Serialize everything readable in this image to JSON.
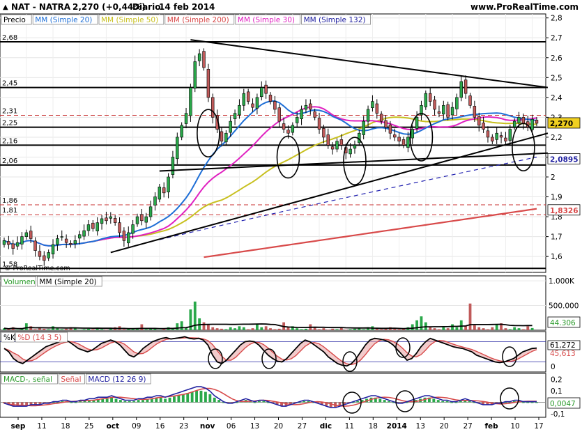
{
  "header": {
    "symbol": "NAT - NATRA",
    "last": "2,270 (+0,44%)",
    "period": "Diario",
    "date": "14 feb 2014",
    "site": "www.ProRealTime.com"
  },
  "price_panel": {
    "legend": [
      {
        "text": "Precio",
        "color": "#000000"
      },
      {
        "text": "MM (Simple 20)",
        "color": "#1f6fd6"
      },
      {
        "text": "MM (Simple 50)",
        "color": "#c8c020"
      },
      {
        "text": "MM (Simple 200)",
        "color": "#d84a4a"
      },
      {
        "text": "MM (Simple 30)",
        "color": "#e020c0"
      },
      {
        "text": "MM (Simple 132)",
        "color": "#2020a0"
      }
    ],
    "watermark": "© ProRealTime.com",
    "level_labels": [
      "2,68",
      "2,45",
      "2,31",
      "2,25",
      "2,16",
      "2,06",
      "1,86",
      "1,81",
      "1,58"
    ],
    "last_badge": "2,270",
    "badge_sma20": "2,0895",
    "badge_sma200": "1,8326"
  },
  "volume_panel": {
    "legend": [
      {
        "text": "Volumen",
        "color": "#000000"
      },
      {
        "text": "MM (Simple 20)",
        "color": "#000000"
      }
    ],
    "axis_labels": [
      "1.000K",
      "500.000"
    ],
    "badge": "44.306"
  },
  "stoch_panel": {
    "legend": [
      {
        "text": "%K",
        "color": "#000000"
      },
      {
        "text": "%D (14 3 5)",
        "color": "#d84a4a"
      }
    ],
    "badge_k": "61,272",
    "badge_d": "45,613",
    "zero_label": "0"
  },
  "macd_panel": {
    "legend": [
      {
        "text": "MACD-, señal",
        "color": "#2a9a2a"
      },
      {
        "text": "Señal",
        "color": "#d84a4a"
      },
      {
        "text": "MACD (12 26 9)",
        "color": "#2020a0"
      }
    ],
    "axis_labels": [
      "0,2",
      "0,1",
      "-0,1"
    ],
    "badge": "0,0047"
  },
  "x_axis": {
    "labels": [
      "sep",
      "11",
      "18",
      "25",
      "oct",
      "09",
      "16",
      "23",
      "nov",
      "06",
      "13",
      "20",
      "27",
      "dic",
      "11",
      "18",
      "2014",
      "13",
      "20",
      "27",
      "feb",
      "10",
      "17"
    ]
  },
  "chart_data": [
    {
      "type": "candlestick",
      "ylim": [
        1.52,
        2.82
      ],
      "y_ticks": [
        1.6,
        1.7,
        1.8,
        1.9,
        2.0,
        2.1,
        2.2,
        2.3,
        2.4,
        2.5,
        2.6,
        2.7,
        2.8
      ],
      "y_tick_labels": [
        "1,6",
        "1,7",
        "1,8",
        "1,9",
        "2",
        "2,1",
        "2,2",
        "2,3",
        "2,4",
        "2,5",
        "2,6",
        "2,7",
        "2,8"
      ],
      "close": [
        1.68,
        1.66,
        1.64,
        1.67,
        1.7,
        1.72,
        1.69,
        1.63,
        1.6,
        1.58,
        1.62,
        1.66,
        1.69,
        1.7,
        1.67,
        1.66,
        1.68,
        1.71,
        1.73,
        1.76,
        1.74,
        1.77,
        1.79,
        1.78,
        1.8,
        1.77,
        1.72,
        1.68,
        1.72,
        1.76,
        1.8,
        1.78,
        1.8,
        1.85,
        1.9,
        1.95,
        1.92,
        2.0,
        2.1,
        2.2,
        2.26,
        2.32,
        2.45,
        2.58,
        2.62,
        2.55,
        2.4,
        2.3,
        2.24,
        2.18,
        2.22,
        2.28,
        2.32,
        2.36,
        2.42,
        2.38,
        2.35,
        2.4,
        2.45,
        2.42,
        2.38,
        2.34,
        2.28,
        2.24,
        2.22,
        2.26,
        2.3,
        2.34,
        2.36,
        2.34,
        2.3,
        2.24,
        2.2,
        2.16,
        2.14,
        2.18,
        2.16,
        2.12,
        2.14,
        2.16,
        2.22,
        2.28,
        2.34,
        2.38,
        2.32,
        2.28,
        2.25,
        2.22,
        2.2,
        2.18,
        2.16,
        2.2,
        2.24,
        2.3,
        2.36,
        2.42,
        2.38,
        2.34,
        2.32,
        2.36,
        2.3,
        2.35,
        2.4,
        2.48,
        2.42,
        2.36,
        2.3,
        2.26,
        2.24,
        2.2,
        2.18,
        2.22,
        2.2,
        2.18,
        2.24,
        2.28,
        2.3,
        2.27,
        2.25,
        2.29,
        2.27
      ],
      "level_lines": [
        2.68,
        2.45,
        2.31,
        2.25,
        2.16,
        2.06,
        1.86,
        1.81,
        1.54
      ],
      "annotations": {
        "last_price": 2.27,
        "sma20_end": 2.0895,
        "sma200_end": 1.8326
      }
    },
    {
      "type": "bar",
      "name": "Volumen",
      "ylim": [
        0,
        1100
      ],
      "y_ticks": [
        500,
        1000
      ],
      "values": [
        40,
        20,
        60,
        10,
        30,
        140,
        80,
        20,
        60,
        30,
        20,
        80,
        40,
        20,
        30,
        60,
        40,
        10,
        20,
        30,
        20,
        40,
        20,
        10,
        30,
        60,
        80,
        20,
        30,
        20,
        40,
        120,
        20,
        30,
        40,
        10,
        20,
        60,
        40,
        140,
        180,
        60,
        420,
        580,
        240,
        160,
        120,
        60,
        40,
        30,
        20,
        60,
        40,
        80,
        60,
        20,
        40,
        120,
        60,
        80,
        40,
        20,
        30,
        160,
        60,
        80,
        40,
        20,
        30,
        120,
        60,
        20,
        40,
        10,
        30,
        20,
        60,
        10,
        20,
        30,
        40,
        20,
        60,
        80,
        40,
        20,
        40,
        60,
        40,
        20,
        30,
        60,
        120,
        200,
        280,
        160,
        60,
        40,
        20,
        60,
        40,
        120,
        60,
        200,
        80,
        540,
        100,
        60,
        40,
        20,
        60,
        120,
        140,
        40,
        20,
        60,
        40,
        20,
        80,
        44
      ]
    },
    {
      "type": "line",
      "name": "%K",
      "ylim": [
        -10,
        110
      ],
      "values": [
        60,
        50,
        30,
        20,
        15,
        25,
        35,
        45,
        55,
        65,
        70,
        75,
        80,
        85,
        80,
        70,
        60,
        55,
        50,
        55,
        65,
        75,
        80,
        85,
        80,
        70,
        55,
        40,
        35,
        45,
        60,
        70,
        80,
        85,
        90,
        92,
        88,
        90,
        92,
        95,
        90,
        88,
        90,
        85,
        70,
        40,
        20,
        15,
        25,
        40,
        55,
        70,
        80,
        82,
        80,
        70,
        55,
        40,
        30,
        22,
        20,
        30,
        45,
        60,
        75,
        85,
        80,
        70,
        60,
        50,
        35,
        25,
        15,
        10,
        8,
        15,
        30,
        50,
        70,
        85,
        90,
        88,
        85,
        80,
        70,
        55,
        40,
        25,
        30,
        45,
        65,
        80,
        90,
        85,
        80,
        75,
        70,
        65,
        62,
        60,
        55,
        50,
        40,
        35,
        30,
        25,
        20,
        18,
        20,
        25,
        30,
        40,
        50,
        55,
        60,
        61
      ]
    },
    {
      "type": "bar",
      "name": "MACD-, señal",
      "ylim": [
        -0.13,
        0.25
      ],
      "y_ticks": [
        0.2,
        0.1,
        -0.1
      ],
      "values": [
        -0.01,
        -0.02,
        -0.03,
        -0.03,
        -0.03,
        -0.03,
        -0.02,
        -0.02,
        -0.02,
        -0.01,
        -0.01,
        0.0,
        0.0,
        0.01,
        0.01,
        0.0,
        0.0,
        0.01,
        0.01,
        0.02,
        0.02,
        0.03,
        0.03,
        0.03,
        0.04,
        0.03,
        0.02,
        0.01,
        0.01,
        0.01,
        0.02,
        0.02,
        0.03,
        0.03,
        0.04,
        0.04,
        0.03,
        0.04,
        0.05,
        0.06,
        0.07,
        0.08,
        0.09,
        0.1,
        0.1,
        0.09,
        0.07,
        0.04,
        0.02,
        0.0,
        -0.01,
        -0.01,
        0.0,
        0.01,
        0.02,
        0.01,
        0.0,
        0.01,
        0.01,
        0.0,
        -0.01,
        -0.02,
        -0.03,
        -0.03,
        -0.02,
        -0.01,
        0.0,
        0.01,
        0.01,
        0.0,
        -0.01,
        -0.02,
        -0.03,
        -0.04,
        -0.04,
        -0.03,
        -0.02,
        -0.01,
        0.0,
        0.01,
        0.02,
        0.03,
        0.04,
        0.04,
        0.03,
        0.02,
        0.01,
        0.0,
        -0.01,
        -0.01,
        0.0,
        0.01,
        0.02,
        0.03,
        0.04,
        0.04,
        0.03,
        0.02,
        0.01,
        0.01,
        0.0,
        0.0,
        0.01,
        0.02,
        0.01,
        0.0,
        -0.01,
        -0.02,
        -0.02,
        -0.02,
        -0.01,
        -0.01,
        0.0,
        0.0,
        0.01,
        0.01,
        0.0,
        0.0,
        0.0,
        0.0
      ]
    }
  ]
}
